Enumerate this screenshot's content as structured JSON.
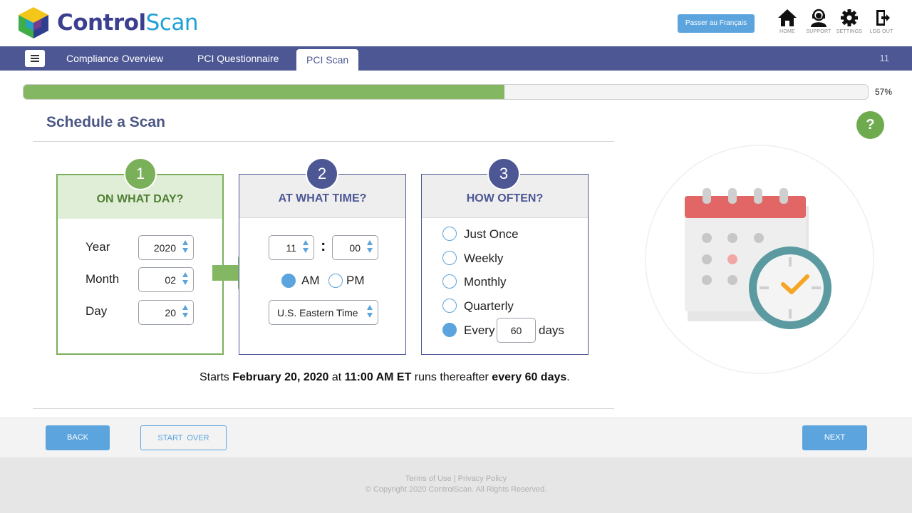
{
  "brand": {
    "name_part1": "Control",
    "name_part2": "Scan"
  },
  "header": {
    "language_button": "Passer au Français",
    "icons": [
      {
        "name": "home",
        "label": "HOME"
      },
      {
        "name": "support",
        "label": "SUPPORT"
      },
      {
        "name": "settings",
        "label": "SETTINGS"
      },
      {
        "name": "logout",
        "label": "LOG OUT"
      }
    ]
  },
  "nav": {
    "tabs": [
      {
        "label": "Compliance Overview",
        "active": false
      },
      {
        "label": "PCI Questionnaire",
        "active": false
      },
      {
        "label": "PCI Scan",
        "active": true
      }
    ],
    "page_number": "11"
  },
  "progress": {
    "percent": 57,
    "label": "57%"
  },
  "page": {
    "title": "Schedule a Scan"
  },
  "steps": [
    {
      "number": "1",
      "title": "ON WHAT DAY?",
      "fields": [
        {
          "label": "Year",
          "value": "2020"
        },
        {
          "label": "Month",
          "value": "02"
        },
        {
          "label": "Day",
          "value": "20"
        }
      ]
    },
    {
      "number": "2",
      "title": "AT WHAT TIME?",
      "hour": "11",
      "separator": ":",
      "minute": "00",
      "am_label": "AM",
      "pm_label": "PM",
      "selected_period": "AM",
      "timezone": "U.S. Eastern Time"
    },
    {
      "number": "3",
      "title": "HOW OFTEN?",
      "options": [
        "Just Once",
        "Weekly",
        "Monthly",
        "Quarterly"
      ],
      "every_label": "Every",
      "every_value": "60",
      "every_unit": "days",
      "selected": "Every"
    }
  ],
  "summary": {
    "prefix": "Starts ",
    "date": "February 20, 2020",
    "mid1": " at ",
    "time": "11:00 AM ET",
    "mid2": " runs thereafter ",
    "interval": "every 60 days",
    "suffix": "."
  },
  "footer_buttons": {
    "back": "BACK",
    "start_over": "START  OVER",
    "next": "NEXT"
  },
  "footer": {
    "links": "Terms of Use | Privacy Policy",
    "copyright": "© Copyright 2020 ControlScan. All Rights Reserved."
  },
  "colors": {
    "nav": "#4c5794",
    "accent": "#5ba4dd",
    "green": "#7ab05a",
    "progress": "#84b762"
  }
}
